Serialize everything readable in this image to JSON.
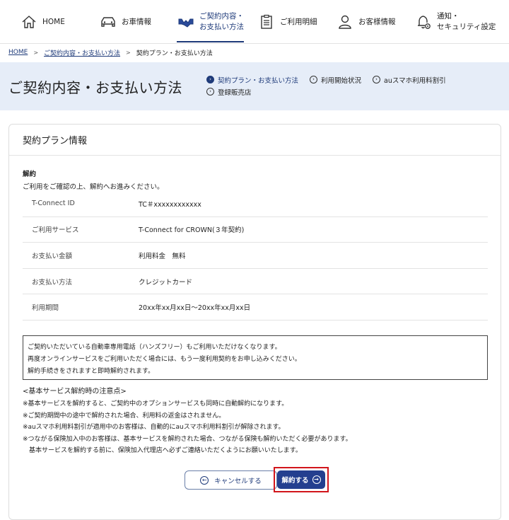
{
  "nav": {
    "home": "HOME",
    "vehicle": "お車情報",
    "contract": "ご契約内容・\nお支払い方法",
    "statement": "ご利用明細",
    "customer": "お客様情報",
    "notify": "通知・\nセキュリティ設定"
  },
  "breadcrumb": {
    "home": "HOME",
    "parent": "ご契約内容・お支払い方法",
    "current": "契約プラン・お支払い方法",
    "separator": ">"
  },
  "page": {
    "title": "ご契約内容・お支払い方法"
  },
  "subnav": {
    "items": [
      {
        "label": "契約プラン・お支払い方法"
      },
      {
        "label": "利用開始状況"
      },
      {
        "label": "auスマホ利用料割引"
      },
      {
        "label": "登録販売店"
      }
    ]
  },
  "card": {
    "heading": "契約プラン情報",
    "section_title": "解約",
    "section_desc": "ご利用をご確認の上、解約へお進みください。"
  },
  "info_rows": [
    {
      "key": "T-Connect ID",
      "value": "TC＃xxxxxxxxxxxx"
    },
    {
      "key": "ご利用サービス",
      "value": "T-Connect for CROWN(３年契約)"
    },
    {
      "key": "お支払い金額",
      "value": "利用料金　無料"
    },
    {
      "key": "お支払い方法",
      "value": "クレジットカード"
    },
    {
      "key": "利用期間",
      "value": "20xx年xx月xx日～20xx年xx月xx日"
    }
  ],
  "notice": [
    "ご契約いただいている自動車専用電話（ハンズフリー）もご利用いただけなくなります。",
    "再度オンラインサービスをご利用いただく場合には、もう一度利用契約をお申し込みください。",
    "解約手続きをされますと即時解約されます。"
  ],
  "caution": {
    "heading": "<基本サービス解約時の注意点>",
    "lines": [
      "※基本サービスを解約すると、ご契約中のオプションサービスも同時に自動解約になります。",
      "※ご契約期間中の途中で解約された場合、利用料の返金はされません。",
      "※auスマホ利用料割引が適用中のお客様は、自動的にauスマホ利用料割引が解除されます。",
      "※つながる保険加入中のお客様は、基本サービスを解約された場合、つながる保険も解約いただく必要があります。",
      "　基本サービスを解約する前に、保険加入代理店へ必ずご連絡いただくようにお願いいたします。"
    ]
  },
  "buttons": {
    "cancel": "キャンセルする",
    "confirm": "解約する"
  },
  "colors": {
    "accent": "#1f3b7a",
    "band_bg": "#e6edf8",
    "primary_button": "#243f8f",
    "highlight_border": "#d2151b"
  },
  "icons": {
    "home": "home-icon",
    "vehicle": "car-icon",
    "contract": "handshake-icon",
    "statement": "clipboard-icon",
    "customer": "person-icon",
    "notify": "bell-gear-icon"
  }
}
